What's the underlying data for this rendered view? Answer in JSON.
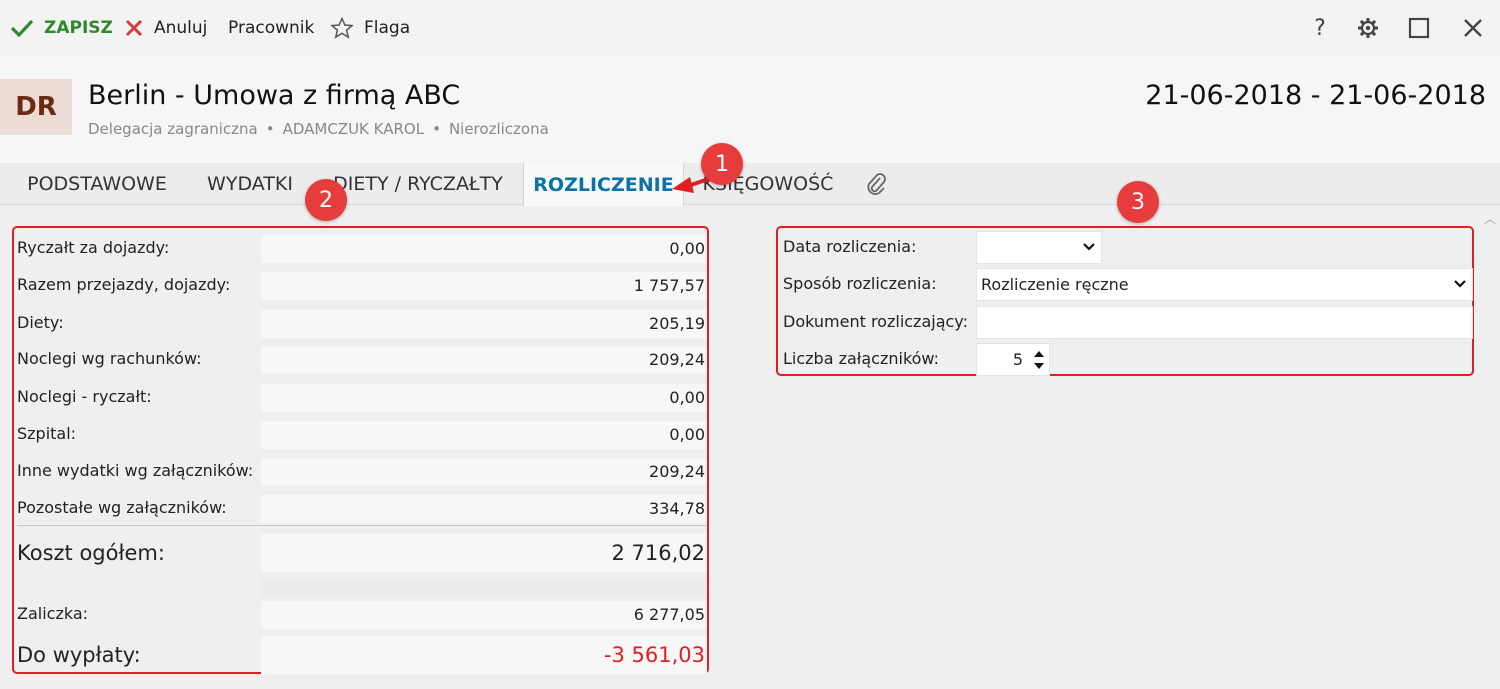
{
  "toolbar": {
    "save": "ZAPISZ",
    "cancel": "Anuluj",
    "worker": "Pracownik",
    "flag": "Flaga"
  },
  "header": {
    "avatar": "DR",
    "title": "Berlin - Umowa z firmą ABC",
    "subtitle": [
      "Delegacja zagraniczna",
      "ADAMCZUK KAROL",
      "Nierozliczona"
    ],
    "date_range": "21-06-2018 - 21-06-2018"
  },
  "tabs": [
    {
      "label": "PODSTAWOWE"
    },
    {
      "label": "WYDATKI"
    },
    {
      "label": "DIETY / RYCZAŁTY"
    },
    {
      "label": "ROZLICZENIE",
      "active": true
    },
    {
      "label": "KSIĘGOWOŚĆ"
    }
  ],
  "summary": {
    "rows": [
      {
        "label": "Ryczałt za dojazdy:",
        "value": "0,00"
      },
      {
        "label": "Razem przejazdy, dojazdy:",
        "value": "1 757,57"
      },
      {
        "label": "Diety:",
        "value": "205,19"
      },
      {
        "label": "Noclegi wg rachunków:",
        "value": "209,24"
      },
      {
        "label": "Noclegi - ryczałt:",
        "value": "0,00"
      },
      {
        "label": "Szpital:",
        "value": "0,00"
      },
      {
        "label": "Inne wydatki wg załączników:",
        "value": "209,24"
      },
      {
        "label": "Pozostałe wg załączników:",
        "value": "334,78"
      }
    ],
    "total": {
      "label": "Koszt ogółem:",
      "value": "2 716,02"
    },
    "advance": {
      "label": "Zaliczka:",
      "value": "6 277,05"
    },
    "payout": {
      "label": "Do wypłaty:",
      "value": "-3 561,03"
    }
  },
  "form": {
    "date_label": "Data rozliczenia:",
    "date_value": "",
    "method_label": "Sposób rozliczenia:",
    "method_value": "Rozliczenie ręczne",
    "document_label": "Dokument rozliczający:",
    "document_value": "",
    "attachments_label": "Liczba załączników:",
    "attachments_value": "5"
  },
  "callouts": [
    "1",
    "2",
    "3"
  ],
  "colors": {
    "save_green": "#2d8a2d",
    "cancel_red": "#d93a3a",
    "active_tab": "#0a72a8",
    "highlight_red": "#e02020",
    "negative_red": "#e02020"
  }
}
